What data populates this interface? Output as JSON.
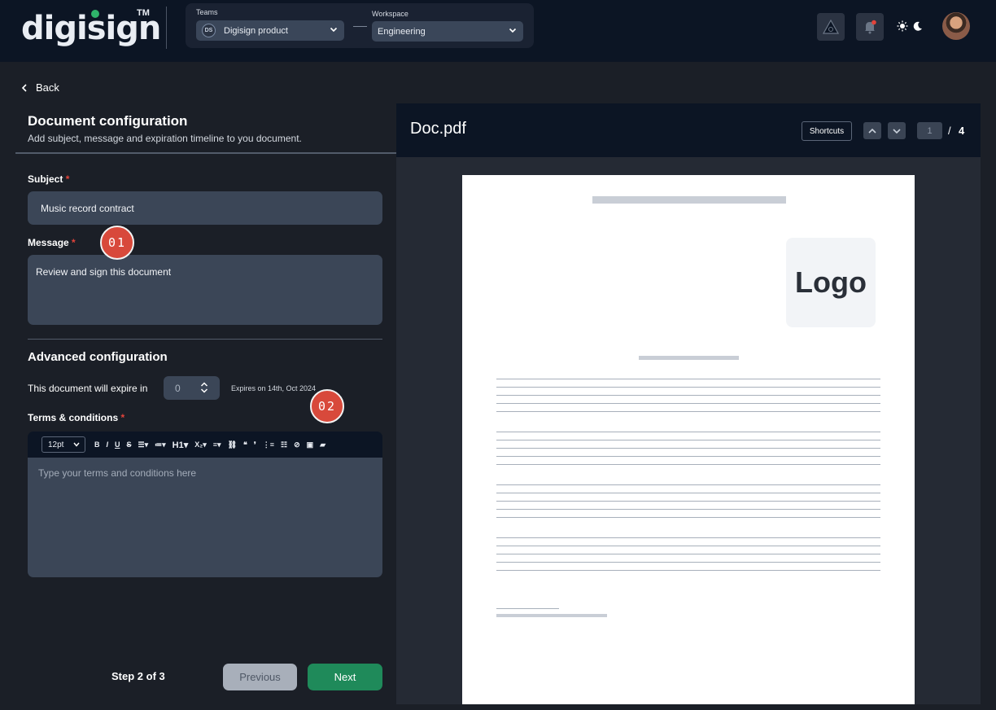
{
  "header": {
    "brand": "digisign",
    "trademark": "TM",
    "teams_label": "Teams",
    "team_initials": "DS",
    "team_value": "Digisign product",
    "workspace_label": "Workspace",
    "workspace_value": "Engineering",
    "icons": [
      "logo-triangle-icon",
      "bell-icon",
      "sun-icon",
      "moon-icon"
    ],
    "notification_dot_color": "#e2433a"
  },
  "left": {
    "back_label": "Back",
    "title": "Document configuration",
    "subtitle": "Add subject, message and expiration timeline to you document.",
    "subject_label": "Subject",
    "subject_value": "Music record contract",
    "message_label": "Message",
    "message_value": "Review and sign this document",
    "required_mark": "*",
    "advanced_title": "Advanced configuration",
    "expire_label": "This document will expire in",
    "expire_value": "0",
    "expires_note": "Expires on 14th, Oct 2024",
    "terms_label": "Terms & conditions",
    "font_size": "12pt",
    "terms_placeholder": "Type your terms and conditions here",
    "step_text": "Step 2 of 3",
    "previous_label": "Previous",
    "next_label": "Next"
  },
  "annotations": {
    "badge_1": "01",
    "badge_2": "02"
  },
  "preview": {
    "doc_name": "Doc.pdf",
    "shortcuts_label": "Shortcuts",
    "current_page": "1",
    "separator": "/",
    "total_pages": "4",
    "logo_text": "Logo"
  },
  "colors": {
    "accent_green": "#1f8a5a",
    "badge_red": "#d8493b",
    "header_bg": "#0c1524"
  }
}
